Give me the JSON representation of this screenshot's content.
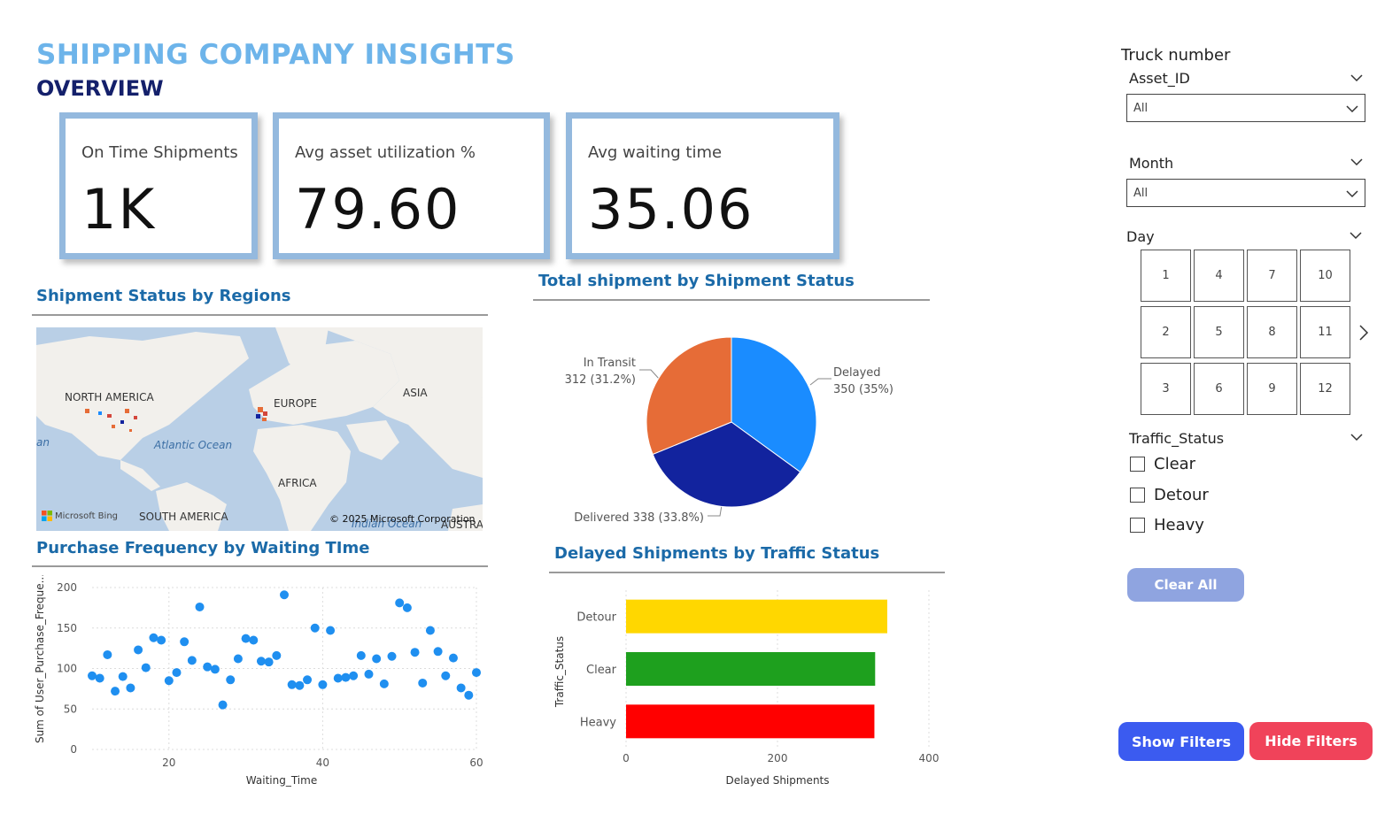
{
  "header": {
    "title": "SHIPPING COMPANY INSIGHTS",
    "subtitle": "OVERVIEW"
  },
  "kpis": [
    {
      "label": "On Time Shipments",
      "value": "1K"
    },
    {
      "label": "Avg asset utilization %",
      "value": "79.60"
    },
    {
      "label": "Avg waiting time",
      "value": "35.06"
    }
  ],
  "map_section": {
    "title": "Shipment Status by Regions",
    "labels": {
      "north_america": "NORTH AMERICA",
      "europe": "EUROPE",
      "asia": "ASIA",
      "africa": "AFRICA",
      "south_america": "SOUTH AMERICA",
      "atlantic": "Atlantic Ocean",
      "indian": "Indian Ocean",
      "australia": "AUSTRA",
      "edge": "an"
    },
    "attribution": "Microsoft Bing",
    "copyright": "© 2025 Microsoft Corporation"
  },
  "colors": {
    "title": "#6db4ea",
    "subtitle": "#14206b",
    "section_title": "#1b6aa8",
    "card_border": "#94b9de",
    "scatter": "#1f8ff0",
    "pie_delayed": "#1a8cff",
    "pie_delivered": "#12239e",
    "pie_in_transit": "#e66c37",
    "bar_detour": "#ffd700",
    "bar_clear": "#1ea01e",
    "bar_heavy": "#ff0000",
    "clear_all": "#8fa4e0",
    "show_filters": "#3b5bf0",
    "hide_filters": "#f0435a"
  },
  "chart_data": [
    {
      "type": "scatter",
      "title": "Purchase Frequency by Waiting TIme",
      "xlabel": "Waiting_Time",
      "ylabel": "Sum of User_Purchase_Freque...",
      "xlim": [
        10,
        60
      ],
      "ylim": [
        0,
        200
      ],
      "xticks": [
        20,
        40,
        60
      ],
      "yticks": [
        0,
        50,
        100,
        150,
        200
      ],
      "grid": true,
      "x": [
        10,
        11,
        12,
        13,
        14,
        15,
        16,
        17,
        18,
        19,
        20,
        21,
        22,
        23,
        24,
        25,
        26,
        27,
        28,
        29,
        30,
        31,
        32,
        33,
        34,
        35,
        36,
        37,
        38,
        39,
        40,
        41,
        42,
        43,
        44,
        45,
        46,
        47,
        48,
        49,
        50,
        51,
        52,
        53,
        54,
        55,
        56,
        57,
        58,
        59,
        60
      ],
      "y": [
        91,
        88,
        117,
        72,
        90,
        76,
        123,
        101,
        138,
        135,
        85,
        95,
        133,
        110,
        176,
        102,
        99,
        55,
        86,
        112,
        137,
        135,
        109,
        108,
        116,
        191,
        80,
        79,
        86,
        150,
        80,
        147,
        88,
        89,
        91,
        116,
        93,
        112,
        81,
        115,
        181,
        175,
        120,
        82,
        147,
        121,
        91,
        113,
        76,
        67,
        95
      ]
    },
    {
      "type": "pie",
      "title": "Total shipment by Shipment Status",
      "slices": [
        {
          "label": "Delayed",
          "value": 350,
          "pct": "35%",
          "text": "350 (35%)"
        },
        {
          "label": "Delivered",
          "value": 338,
          "pct": "33.8%",
          "text": "Delivered 338 (33.8%)"
        },
        {
          "label": "In Transit",
          "value": 312,
          "pct": "31.2%",
          "text": "312 (31.2%)"
        }
      ]
    },
    {
      "type": "bar",
      "orientation": "horizontal",
      "title": "Delayed Shipments by Traffic Status",
      "xlabel": "Delayed Shipments",
      "ylabel": "Traffic_Status",
      "xlim": [
        0,
        400
      ],
      "xticks": [
        0,
        200,
        400
      ],
      "categories": [
        "Detour",
        "Clear",
        "Heavy"
      ],
      "values": [
        345,
        329,
        328
      ],
      "grid": true
    }
  ],
  "filters": {
    "truck_title": "Truck number",
    "asset_label": "Asset_ID",
    "asset_value": "All",
    "month_label": "Month",
    "month_value": "All",
    "day_label": "Day",
    "days": [
      "1",
      "4",
      "7",
      "10",
      "2",
      "5",
      "8",
      "11",
      "3",
      "6",
      "9",
      "12"
    ],
    "traffic_label": "Traffic_Status",
    "traffic_options": [
      "Clear",
      "Detour",
      "Heavy"
    ],
    "clear_all": "Clear All"
  },
  "buttons": {
    "show_filters": "Show Filters",
    "hide_filters": "Hide Filters"
  }
}
